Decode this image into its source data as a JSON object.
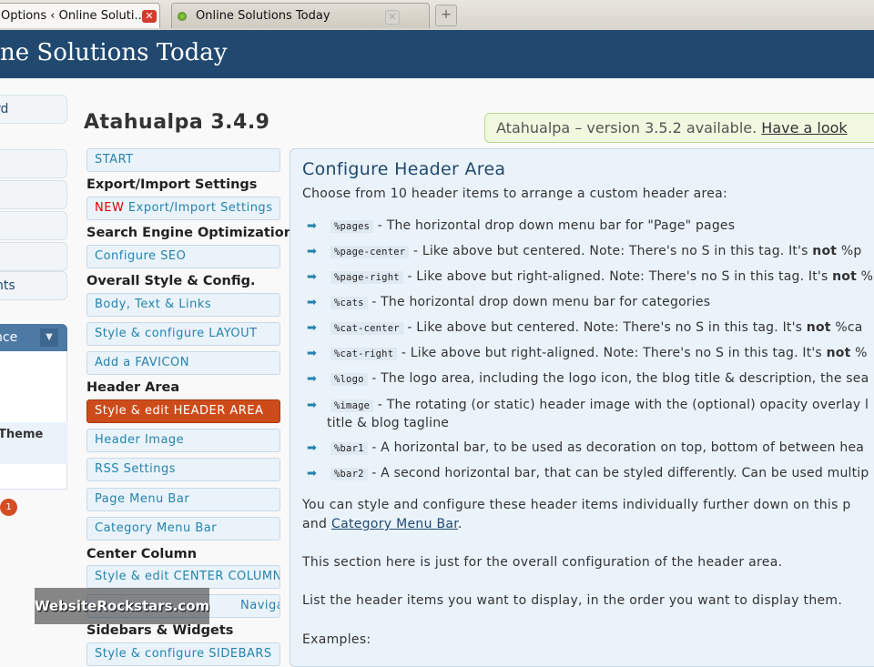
{
  "browser": {
    "tabs": [
      {
        "title": "Options ‹ Online Soluti...",
        "close": "✕"
      },
      {
        "title": "Online Solutions Today",
        "close": "✕"
      }
    ],
    "new_tab": "+"
  },
  "header": {
    "site_title": "ne Solutions Today"
  },
  "admin_menu": {
    "items": [
      "rd",
      "",
      "",
      "",
      "",
      "nts"
    ],
    "appearance": "nce",
    "appearance_arrow": "▼",
    "theme_item": "Theme",
    "badge": "1"
  },
  "page": {
    "title": "Atahualpa 3.4.9",
    "notice_text": "Atahualpa – version 3.5.2 available. ",
    "notice_link": "Have a look"
  },
  "plugin_menu": {
    "start": "START",
    "h_export": "Export/Import Settings",
    "new": "NEW",
    "export_item": " Export/Import Settings",
    "h_seo": "Search Engine Optimization",
    "seo_item": "Configure SEO",
    "h_style": "Overall Style & Config.",
    "body_item": "Body, Text & Links",
    "layout_item": "Style & configure LAYOUT",
    "favicon_item": "Add a FAVICON",
    "h_header": "Header Area",
    "header_item": "Style & edit HEADER AREA",
    "header_image": "Header Image",
    "rss": "RSS Settings",
    "page_menu": "Page Menu Bar",
    "category_menu": "Category Menu Bar",
    "h_center": "Center Column",
    "center_item": "Style & edit CENTER COLUMN",
    "navigation": "Navigation",
    "h_sidebars": "Sidebars & Widgets",
    "sidebars_item": "Style & configure SIDEBARS"
  },
  "panel": {
    "title": "Configure Header Area",
    "intro": "Choose from 10 header items to arrange a custom header area:",
    "items": [
      {
        "tag": "%pages",
        "text": " - The horizontal drop down menu bar for \"Page\" pages",
        "bold": "",
        "tail": ""
      },
      {
        "tag": "%page-center",
        "text": " - Like above but centered. Note: There's no S in this tag. It's ",
        "bold": "not",
        "tail": " %p"
      },
      {
        "tag": "%page-right",
        "text": " - Like above but right-aligned. Note: There's no S in this tag. It's ",
        "bold": "not",
        "tail": " %"
      },
      {
        "tag": "%cats",
        "text": " - The horizontal drop down menu bar for categories",
        "bold": "",
        "tail": ""
      },
      {
        "tag": "%cat-center",
        "text": " - Like above but centered. Note: There's no S in this tag. It's ",
        "bold": "not",
        "tail": " %ca"
      },
      {
        "tag": "%cat-right",
        "text": " - Like above but right-aligned. Note: There's no S in this tag. It's ",
        "bold": "not",
        "tail": " %"
      },
      {
        "tag": "%logo",
        "text": " - The logo area, including the logo icon, the blog title & description, the sea",
        "bold": "",
        "tail": ""
      },
      {
        "tag": "%image",
        "text": " - The rotating (or static) header image with the (optional) opacity overlay l",
        "bold": "",
        "tail": ""
      },
      {
        "tag": "%bar1",
        "text": " - A horizontal bar, to be used as decoration on top, bottom of between hea",
        "bold": "",
        "tail": ""
      },
      {
        "tag": "%bar2",
        "text": " - A second horizontal bar, that can be styled differently. Can be used multip",
        "bold": "",
        "tail": ""
      }
    ],
    "image_cont": "title & blog tagline",
    "para1": "You can style and configure these header items individually further down on this p",
    "para1b_pre": "and ",
    "para1b_link": "Category Menu Bar",
    "para1b_post": ".",
    "para2": "This section here is just for the overall configuration of the header area.",
    "para3": "List the header items you want to display, in the order you want to display them.",
    "para4": "Examples:"
  },
  "watermark": "WebsiteRockstars.com"
}
